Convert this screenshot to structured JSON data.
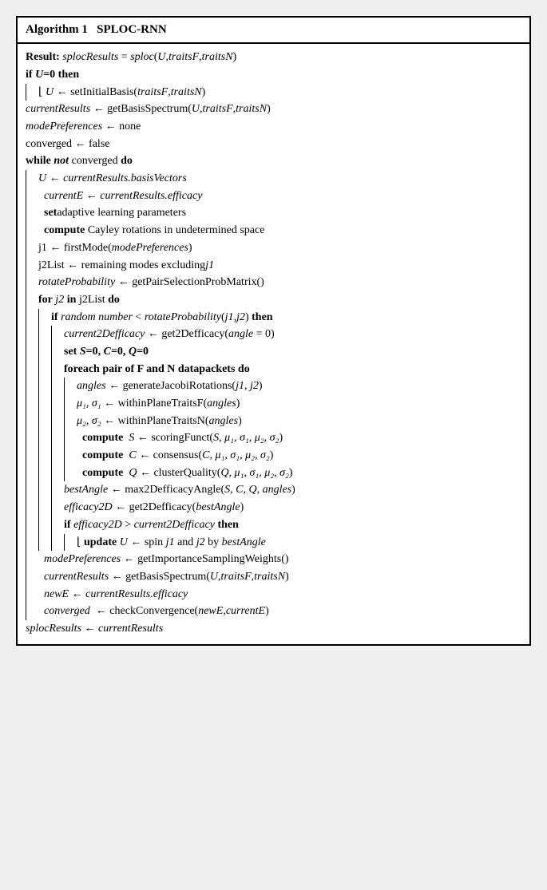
{
  "algorithm": {
    "title_num": "Algorithm 1",
    "title_name": "SPLOC-RNN",
    "result_label": "Result:",
    "result_text": "splocResults = sploc(U, traitsF, traitsN)",
    "lines": [
      {
        "indent": 0,
        "text": "if U=0 then"
      },
      {
        "indent": 1,
        "text": "⌊  U ← setInitialBasis(traitsF, traitsN)"
      },
      {
        "indent": 0,
        "text": "currentResults ← getBasisSpectrum(U, traitsF, traitsN)"
      },
      {
        "indent": 0,
        "text": "modePreferences ← none"
      },
      {
        "indent": 0,
        "text": "converged ← false"
      },
      {
        "indent": 0,
        "text": "while not converged do"
      },
      {
        "indent": 1,
        "text": "U ← currentResults.basisVectors"
      },
      {
        "indent": 1,
        "text": "currentE ← currentResults.efficacy"
      },
      {
        "indent": 1,
        "text": "set adaptive learning parameters"
      },
      {
        "indent": 1,
        "text": "compute Cayley rotations in undetermined space"
      },
      {
        "indent": 1,
        "text": "j1 ← firstMode(modePreferences)"
      },
      {
        "indent": 1,
        "text": "j2List ← remaining modes excluding j1"
      },
      {
        "indent": 1,
        "text": "rotateProbability ← getPairSelectionProbMatrix()"
      },
      {
        "indent": 1,
        "text": "for j2 in j2List do"
      },
      {
        "indent": 2,
        "text": "if random number < rotateProbability(j1,j2) then"
      },
      {
        "indent": 3,
        "text": "current2Defficacy ← get2Defficacy(angle = 0)"
      },
      {
        "indent": 3,
        "text": "set S=0, C=0, Q=0"
      },
      {
        "indent": 3,
        "text": "foreach pair of F and N datapackets do"
      },
      {
        "indent": 4,
        "text": "angles ← generateJacobiRotations(j1, j2)"
      },
      {
        "indent": 4,
        "text": "μ₁, σ₁ ← withinPlaneTraitsF(angles)"
      },
      {
        "indent": 4,
        "text": "μ₂, σ₂ ← withinPlaneTraitsN(angles)"
      },
      {
        "indent": 4,
        "text": "compute  S ← scoringFunct(S, μ₁, σ₁, μ₂, σ₂)"
      },
      {
        "indent": 4,
        "text": "compute  C ← consensus(C, μ₁, σ₁, μ₂, σ₂)"
      },
      {
        "indent": 4,
        "text": "compute  Q ← clusterQuality(Q, μ₁, σ₁, μ₂, σ₂)"
      },
      {
        "indent": 3,
        "text": "bestAngle ← max2DefficacyAngle(S, C, Q, angles)"
      },
      {
        "indent": 3,
        "text": "efficacy2D ← get2Defficacy(bestAngle)"
      },
      {
        "indent": 3,
        "text": "if efficacy2D > current2Defficacy then"
      },
      {
        "indent": 4,
        "text": "⌊  update U ← spin j1 and j2 by bestAngle"
      },
      {
        "indent": 1,
        "text": "modePreferences ← getImportanceSamplingWeights()"
      },
      {
        "indent": 1,
        "text": "currentResults ← getBasisSpectrum(U, traitsF, traitsN)"
      },
      {
        "indent": 1,
        "text": "newE ← currentResults.efficacy"
      },
      {
        "indent": 1,
        "text": "converged  ← checkConvergence(newE, currentE)"
      },
      {
        "indent": 0,
        "text": "splocResults ← currentResults"
      }
    ]
  }
}
